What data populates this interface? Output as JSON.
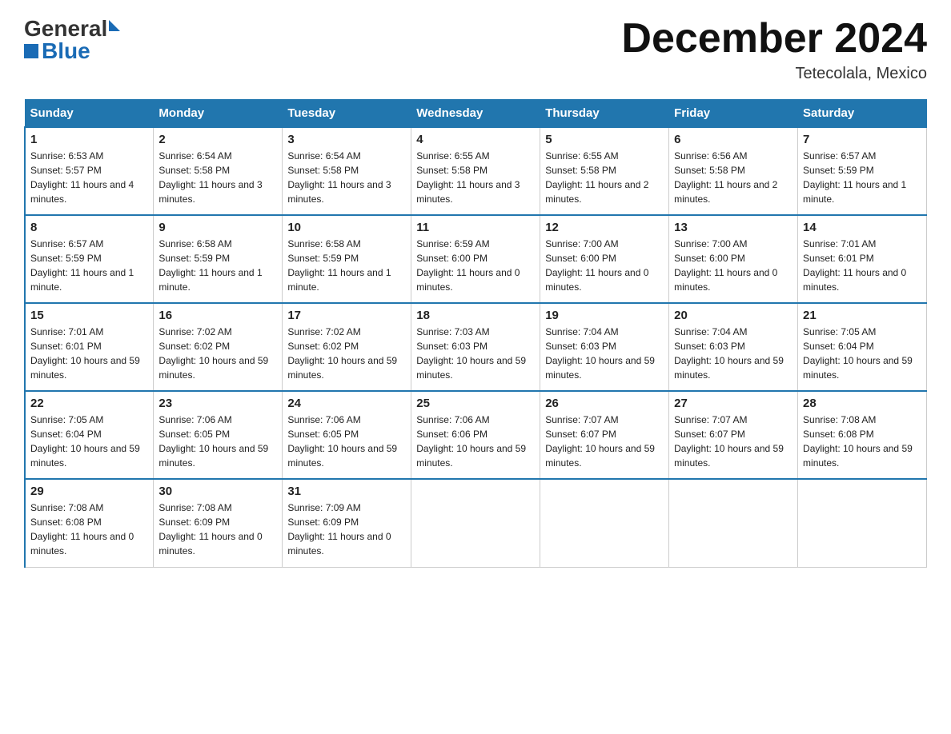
{
  "header": {
    "logo_general": "General",
    "logo_blue": "Blue",
    "month_title": "December 2024",
    "location": "Tetecolala, Mexico"
  },
  "days_of_week": [
    "Sunday",
    "Monday",
    "Tuesday",
    "Wednesday",
    "Thursday",
    "Friday",
    "Saturday"
  ],
  "weeks": [
    [
      {
        "day": "1",
        "sunrise": "6:53 AM",
        "sunset": "5:57 PM",
        "daylight": "11 hours and 4 minutes."
      },
      {
        "day": "2",
        "sunrise": "6:54 AM",
        "sunset": "5:58 PM",
        "daylight": "11 hours and 3 minutes."
      },
      {
        "day": "3",
        "sunrise": "6:54 AM",
        "sunset": "5:58 PM",
        "daylight": "11 hours and 3 minutes."
      },
      {
        "day": "4",
        "sunrise": "6:55 AM",
        "sunset": "5:58 PM",
        "daylight": "11 hours and 3 minutes."
      },
      {
        "day": "5",
        "sunrise": "6:55 AM",
        "sunset": "5:58 PM",
        "daylight": "11 hours and 2 minutes."
      },
      {
        "day": "6",
        "sunrise": "6:56 AM",
        "sunset": "5:58 PM",
        "daylight": "11 hours and 2 minutes."
      },
      {
        "day": "7",
        "sunrise": "6:57 AM",
        "sunset": "5:59 PM",
        "daylight": "11 hours and 1 minute."
      }
    ],
    [
      {
        "day": "8",
        "sunrise": "6:57 AM",
        "sunset": "5:59 PM",
        "daylight": "11 hours and 1 minute."
      },
      {
        "day": "9",
        "sunrise": "6:58 AM",
        "sunset": "5:59 PM",
        "daylight": "11 hours and 1 minute."
      },
      {
        "day": "10",
        "sunrise": "6:58 AM",
        "sunset": "5:59 PM",
        "daylight": "11 hours and 1 minute."
      },
      {
        "day": "11",
        "sunrise": "6:59 AM",
        "sunset": "6:00 PM",
        "daylight": "11 hours and 0 minutes."
      },
      {
        "day": "12",
        "sunrise": "7:00 AM",
        "sunset": "6:00 PM",
        "daylight": "11 hours and 0 minutes."
      },
      {
        "day": "13",
        "sunrise": "7:00 AM",
        "sunset": "6:00 PM",
        "daylight": "11 hours and 0 minutes."
      },
      {
        "day": "14",
        "sunrise": "7:01 AM",
        "sunset": "6:01 PM",
        "daylight": "11 hours and 0 minutes."
      }
    ],
    [
      {
        "day": "15",
        "sunrise": "7:01 AM",
        "sunset": "6:01 PM",
        "daylight": "10 hours and 59 minutes."
      },
      {
        "day": "16",
        "sunrise": "7:02 AM",
        "sunset": "6:02 PM",
        "daylight": "10 hours and 59 minutes."
      },
      {
        "day": "17",
        "sunrise": "7:02 AM",
        "sunset": "6:02 PM",
        "daylight": "10 hours and 59 minutes."
      },
      {
        "day": "18",
        "sunrise": "7:03 AM",
        "sunset": "6:03 PM",
        "daylight": "10 hours and 59 minutes."
      },
      {
        "day": "19",
        "sunrise": "7:04 AM",
        "sunset": "6:03 PM",
        "daylight": "10 hours and 59 minutes."
      },
      {
        "day": "20",
        "sunrise": "7:04 AM",
        "sunset": "6:03 PM",
        "daylight": "10 hours and 59 minutes."
      },
      {
        "day": "21",
        "sunrise": "7:05 AM",
        "sunset": "6:04 PM",
        "daylight": "10 hours and 59 minutes."
      }
    ],
    [
      {
        "day": "22",
        "sunrise": "7:05 AM",
        "sunset": "6:04 PM",
        "daylight": "10 hours and 59 minutes."
      },
      {
        "day": "23",
        "sunrise": "7:06 AM",
        "sunset": "6:05 PM",
        "daylight": "10 hours and 59 minutes."
      },
      {
        "day": "24",
        "sunrise": "7:06 AM",
        "sunset": "6:05 PM",
        "daylight": "10 hours and 59 minutes."
      },
      {
        "day": "25",
        "sunrise": "7:06 AM",
        "sunset": "6:06 PM",
        "daylight": "10 hours and 59 minutes."
      },
      {
        "day": "26",
        "sunrise": "7:07 AM",
        "sunset": "6:07 PM",
        "daylight": "10 hours and 59 minutes."
      },
      {
        "day": "27",
        "sunrise": "7:07 AM",
        "sunset": "6:07 PM",
        "daylight": "10 hours and 59 minutes."
      },
      {
        "day": "28",
        "sunrise": "7:08 AM",
        "sunset": "6:08 PM",
        "daylight": "10 hours and 59 minutes."
      }
    ],
    [
      {
        "day": "29",
        "sunrise": "7:08 AM",
        "sunset": "6:08 PM",
        "daylight": "11 hours and 0 minutes."
      },
      {
        "day": "30",
        "sunrise": "7:08 AM",
        "sunset": "6:09 PM",
        "daylight": "11 hours and 0 minutes."
      },
      {
        "day": "31",
        "sunrise": "7:09 AM",
        "sunset": "6:09 PM",
        "daylight": "11 hours and 0 minutes."
      },
      null,
      null,
      null,
      null
    ]
  ]
}
